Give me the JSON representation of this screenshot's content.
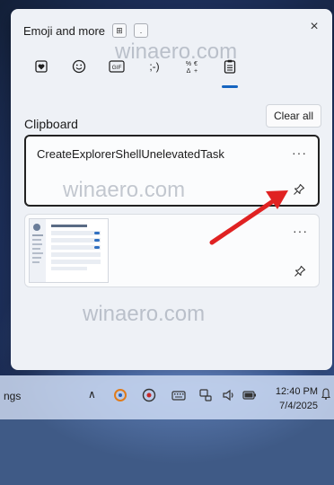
{
  "panel": {
    "title": "Emoji and more",
    "hotkey_win": "⊞",
    "hotkey_dot": ".",
    "close_label": "×"
  },
  "tabs": [
    {
      "label": "♥",
      "name": "tab-recent-emoji"
    },
    {
      "label": "☺",
      "name": "tab-emoji"
    },
    {
      "label": "GIF",
      "name": "tab-gif"
    },
    {
      "label": ";-)",
      "name": "tab-kaomoji"
    },
    {
      "label": "%Ω",
      "name": "tab-symbols"
    },
    {
      "label": "clipboard",
      "name": "tab-clipboard"
    }
  ],
  "clipboard": {
    "section_title": "Clipboard",
    "clear_all_label": "Clear all",
    "items": [
      {
        "type": "text",
        "text": "CreateExplorerShellUnelevatedTask",
        "more": "···"
      },
      {
        "type": "image",
        "more": "···"
      }
    ]
  },
  "annotation": {
    "arrow_color": "#e02222"
  },
  "taskbar": {
    "left_text": "ngs",
    "overflow_label": "∧",
    "time": "12:40 PM",
    "date": "7/4/2025"
  },
  "watermark": "winaero.com",
  "colors": {
    "accent": "#1565c0",
    "arrow": "#e02222"
  }
}
